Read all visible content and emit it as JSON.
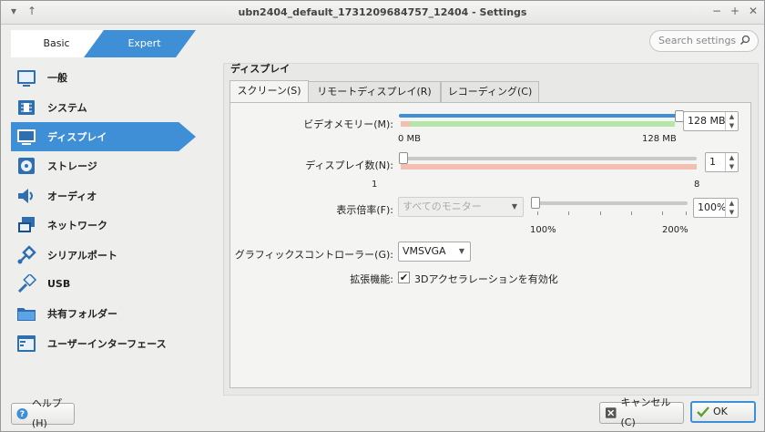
{
  "window": {
    "title": "ubn2404_default_1731209684757_12404 - Settings",
    "left_controls": [
      "▾",
      "↑"
    ],
    "right_controls": [
      "−",
      "+",
      "✕"
    ]
  },
  "mode": {
    "basic": "Basic",
    "expert": "Expert",
    "selected": "Expert"
  },
  "search": {
    "placeholder": "Search settings"
  },
  "sidebar": {
    "items": [
      {
        "label": "一般",
        "icon": "general-icon"
      },
      {
        "label": "システム",
        "icon": "system-chip-icon"
      },
      {
        "label": "ディスプレイ",
        "icon": "display-monitor-icon",
        "active": true
      },
      {
        "label": "ストレージ",
        "icon": "storage-disk-icon"
      },
      {
        "label": "オーディオ",
        "icon": "audio-speaker-icon"
      },
      {
        "label": "ネットワーク",
        "icon": "network-icon"
      },
      {
        "label": "シリアルポート",
        "icon": "serial-port-icon"
      },
      {
        "label": "USB",
        "icon": "usb-icon"
      },
      {
        "label": "共有フォルダー",
        "icon": "shared-folder-icon"
      },
      {
        "label": "ユーザーインターフェース",
        "icon": "user-interface-icon"
      }
    ]
  },
  "section": {
    "title": "ディスプレイ"
  },
  "tabs": [
    {
      "label": "スクリーン(S)",
      "active": true
    },
    {
      "label": "リモートディスプレイ(R)"
    },
    {
      "label": "レコーディング(C)"
    }
  ],
  "screen": {
    "video_memory": {
      "label": "ビデオメモリー(M):",
      "value": "128 MB",
      "min": "0 MB",
      "max": "128 MB",
      "fraction": 1.0
    },
    "monitor_count": {
      "label": "ディスプレイ数(N):",
      "value": "1",
      "min": "1",
      "max": "8",
      "fraction": 0.0
    },
    "scale_factor": {
      "label": "表示倍率(F):",
      "monitor_select": "すべてのモニター",
      "value": "100%",
      "min": "100%",
      "max": "200%",
      "fraction": 0.0
    },
    "graphics_controller": {
      "label": "グラフィックスコントローラー(G):",
      "value": "VMSVGA"
    },
    "acceleration": {
      "label": "拡張機能:",
      "checkbox_label": "3Dアクセラレーションを有効化",
      "checked": true
    }
  },
  "buttons": {
    "help": "ヘルプ(H)",
    "cancel": "キャンセル(C)",
    "ok": "OK"
  },
  "colors": {
    "accent": "#3f8fd6",
    "zone_green": "#b3e6a8",
    "zone_red": "#f2bfb0"
  }
}
